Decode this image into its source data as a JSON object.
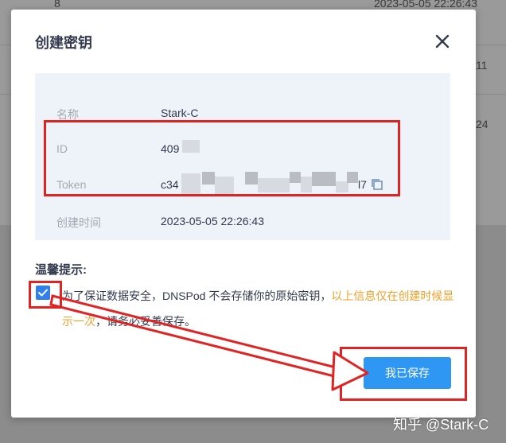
{
  "background": {
    "row1_value": "8",
    "row1_time": "2023-05-05 22:26:43",
    "row2_value": "11",
    "row3_value": "24"
  },
  "modal": {
    "title": "创建密钥",
    "close_icon": "close-icon",
    "fields": [
      {
        "label": "名称",
        "value": "Stark-C"
      },
      {
        "label": "ID",
        "value": "409"
      },
      {
        "label": "Token",
        "value_prefix": "c34",
        "value_suffix": "l7",
        "copy_icon": "copy-icon"
      },
      {
        "label": "创建时间",
        "value": "2023-05-05 22:26:43"
      }
    ],
    "tip_title": "温馨提示:",
    "tip_text": "为了保证数据安全，DNSPod 不会存储你的原始密钥，",
    "tip_highlight": "以上信息仅在创建时候显示一次",
    "tip_text_end": "，请务必妥善保存。",
    "checkbox_checked": true,
    "save_button": "我已保存",
    "accent_color": "#2e97f4",
    "highlight_color": "#f0a02b"
  },
  "watermark": "知乎 @Stark-C"
}
